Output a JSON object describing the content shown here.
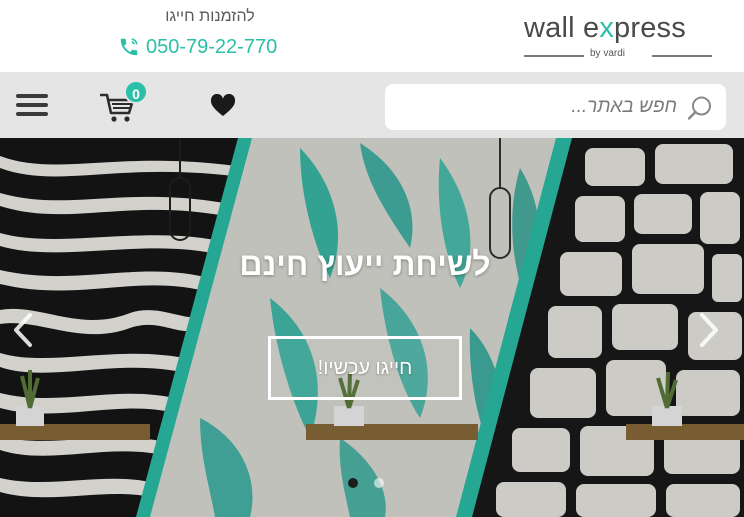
{
  "header": {
    "logo": {
      "brand_prefix": "wall e",
      "brand_x": "x",
      "brand_suffix": "press",
      "sub": "by vardi"
    },
    "order_label": "להזמנות חייגו",
    "phone": "050-79-22-770",
    "phone_icon": "phone-icon"
  },
  "toolbar": {
    "menu_icon": "hamburger-menu-icon",
    "cart_icon": "shopping-cart-icon",
    "cart_count": "0",
    "wishlist_icon": "heart-icon",
    "search": {
      "placeholder": "חפש באתר...",
      "icon": "search-icon"
    }
  },
  "hero": {
    "title": "לשיחת ייעוץ חינם",
    "cta_label": "חייגו עכשיו!",
    "arrow_left": "chevron-left-icon",
    "arrow_right": "chevron-right-icon",
    "slides_count": 2,
    "active_slide": 1
  },
  "colors": {
    "accent": "#2bbfa8",
    "toolbar_bg": "#e5e5e5",
    "text_dark": "#3a3a3a"
  }
}
